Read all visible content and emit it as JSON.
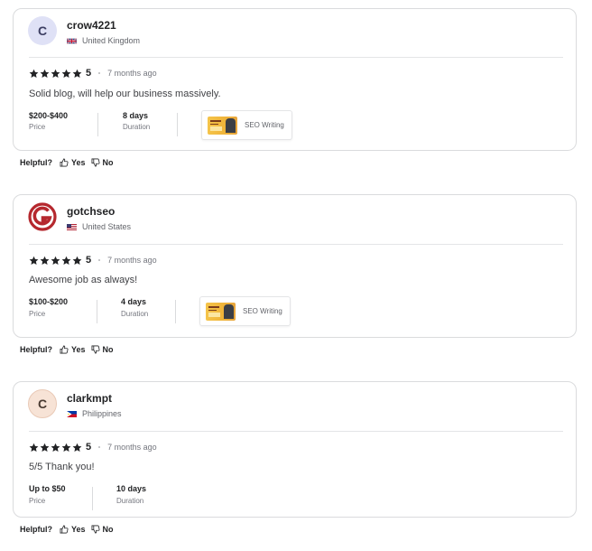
{
  "reviews": [
    {
      "avatar_letter": "C",
      "username": "crow4221",
      "country": "United Kingdom",
      "rating": "5",
      "time_ago": "7 months ago",
      "text": "Solid blog, will help our business massively.",
      "price": "$200-$400",
      "price_label": "Price",
      "duration": "8 days",
      "duration_label": "Duration",
      "gig_title": "SEO Writing"
    },
    {
      "username": "gotchseo",
      "country": "United States",
      "rating": "5",
      "time_ago": "7 months ago",
      "text": "Awesome job as always!",
      "price": "$100-$200",
      "price_label": "Price",
      "duration": "4 days",
      "duration_label": "Duration",
      "gig_title": "SEO Writing"
    },
    {
      "avatar_letter": "C",
      "username": "clarkmpt",
      "country": "Philippines",
      "rating": "5",
      "time_ago": "7 months ago",
      "text": "5/5 Thank you!",
      "price": "Up to $50",
      "price_label": "Price",
      "duration": "10 days",
      "duration_label": "Duration"
    }
  ],
  "helpful": {
    "label": "Helpful?",
    "yes": "Yes",
    "no": "No"
  },
  "colors": {
    "star": "#222325",
    "border": "#dadbdd",
    "logo_red": "#b5282e"
  }
}
